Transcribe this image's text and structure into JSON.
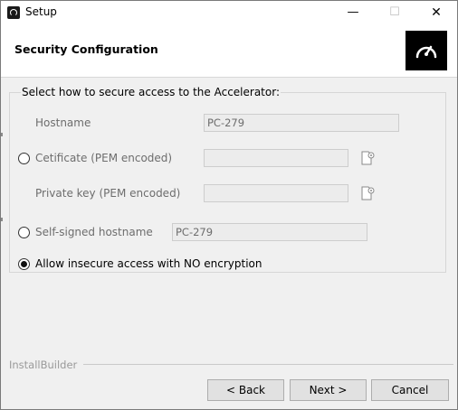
{
  "window": {
    "title": "Setup",
    "minimize": "—",
    "maximize": "☐",
    "close": "✕"
  },
  "header": {
    "title": "Security Configuration"
  },
  "group": {
    "label": "Select how to secure access to the Accelerator:"
  },
  "hostname": {
    "label": "Hostname",
    "value": "PC-279"
  },
  "certificate": {
    "label": "Cetificate (PEM encoded)",
    "value": "",
    "selected": false
  },
  "private_key": {
    "label": "Private key (PEM encoded)",
    "value": ""
  },
  "self_signed": {
    "label": "Self-signed hostname",
    "value": "PC-279",
    "selected": false
  },
  "insecure": {
    "label": "Allow insecure access with NO encryption",
    "selected": true
  },
  "footer": {
    "brand": "InstallBuilder"
  },
  "buttons": {
    "back": "< Back",
    "next": "Next >",
    "cancel": "Cancel"
  }
}
